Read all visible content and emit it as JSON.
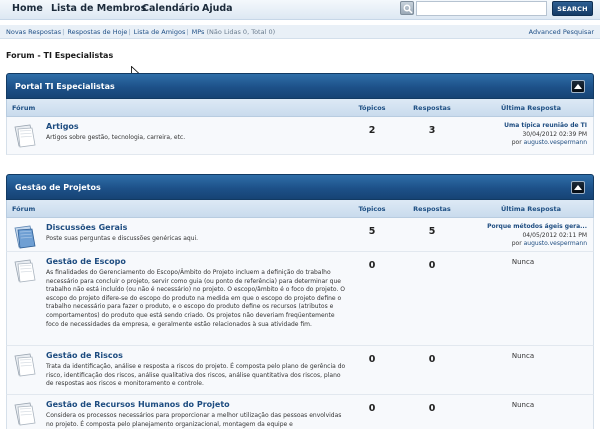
{
  "topnav": {
    "items": [
      "Home",
      "Lista de Membros",
      "Calendário",
      "Ajuda"
    ],
    "search_placeholder": "",
    "search_button": "SEARCH"
  },
  "subnav": {
    "links": [
      "Novas Respostas",
      "Respostas de Hoje",
      "Lista de Amigos",
      "MPs"
    ],
    "pm_status": "(Não Lidas 0, Total 0)",
    "advanced_search": "Advanced Pesquisar"
  },
  "breadcrumb": "Forum - TI Especialistas",
  "columns": {
    "forum": "Fórum",
    "topics": "Tópicos",
    "posts": "Respostas",
    "last_post": "Última Resposta"
  },
  "categories": [
    {
      "title": "Portal TI Especialistas",
      "forums": [
        {
          "name": "Artigos",
          "description": "Artigos sobre gestão, tecnologia, carreira, etc.",
          "topics": "2",
          "posts": "3",
          "last_post": {
            "title": "Uma típica reunião de TI",
            "date": "30/04/2012",
            "time": "02:39 PM",
            "by": "por",
            "user": "augusto.vespermann"
          }
        }
      ]
    },
    {
      "title": "Gestão de Projetos",
      "forums": [
        {
          "name": "Discussões Gerais",
          "description": "Poste suas perguntas e discussões genéricas aqui.",
          "topics": "5",
          "posts": "5",
          "last_post": {
            "title": "Porque métodos ágeis gera...",
            "date": "04/05/2012",
            "time": "02:11 PM",
            "by": "por",
            "user": "augusto.vespermann"
          }
        },
        {
          "name": "Gestão de Escopo",
          "description": "As finalidades do Gerenciamento do Escopo/Âmbito do Projeto incluem a definição do trabalho necessário para concluir o projeto, servir como guia (ou ponto de referência) para determinar que trabalho não está incluído (ou não é necessário) no projeto. O escopo/âmbito é o foco do projeto. O escopo do projeto difere-se do escopo do produto na medida em que o escopo do projeto define o trabalho necessário para fazer o produto, e o escopo do produto define os recursos (atributos e comportamentos) do produto que está sendo criado. Os projetos não deveriam freqüentemente foco de necessidades da empresa, e geralmente estão relacionados à sua atividade fim.",
          "topics": "0",
          "posts": "0",
          "last_post_none": "Nunca"
        },
        {
          "name": "Gestão de Riscos",
          "description": "Trata da identificação, análise e resposta a riscos do projeto. É composta pelo plano de gerência do risco, identificação dos riscos, análise qualitativa dos riscos, análise quantitativa dos riscos, plano de respostas aos riscos e monitoramento e controle.",
          "topics": "0",
          "posts": "0",
          "last_post_none": "Nunca"
        },
        {
          "name": "Gestão de Recursos Humanos do Projeto",
          "description": "Considera os processos necessários para proporcionar a melhor utilização das pessoas envolvidas no projeto. É composta pelo planejamento organizacional, montagem da equipe e",
          "topics": "0",
          "posts": "0",
          "last_post_none": "Nunca"
        }
      ]
    }
  ]
}
